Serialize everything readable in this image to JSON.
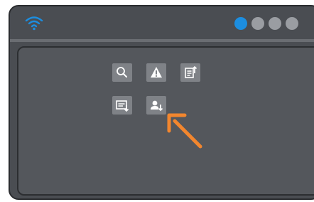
{
  "window": {
    "traffic_dots": [
      {
        "name": "dot-1",
        "state": "active"
      },
      {
        "name": "dot-2",
        "state": "inactive"
      },
      {
        "name": "dot-3",
        "state": "inactive"
      },
      {
        "name": "dot-4",
        "state": "inactive"
      }
    ]
  },
  "toolbar": {
    "icons": [
      "search-icon",
      "warning-icon",
      "upload-list-icon",
      "list-download-icon",
      "user-download-icon"
    ]
  },
  "colors": {
    "accent": "#1c8ee0",
    "pointer": "#f2862e",
    "frame": "#4a4d52",
    "panel": "#54575c",
    "button": "#7f8287"
  }
}
